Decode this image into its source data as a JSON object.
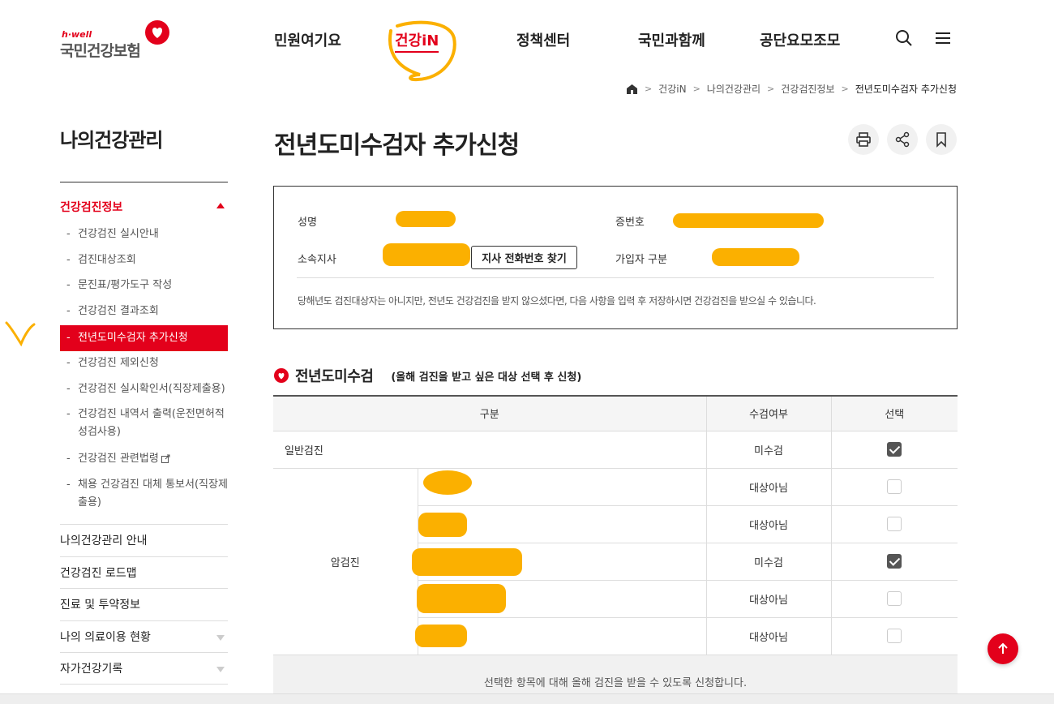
{
  "logo": {
    "small": "h·well",
    "name": "국민건강보험"
  },
  "nav": {
    "items": [
      "민원여기요",
      "건강iN",
      "정책센터",
      "국민과함께",
      "공단요모조모"
    ],
    "active_index": 1
  },
  "icons": {
    "search": "search-icon",
    "menu": "hamburger-menu-icon",
    "home": "home-icon",
    "print": "print-icon",
    "share": "share-icon",
    "bookmark": "bookmark-icon",
    "top": "arrow-up-icon",
    "external": "external-link-icon"
  },
  "breadcrumb": [
    "건강iN",
    "나의건강관리",
    "건강검진정보",
    "전년도미수검자 추가신청"
  ],
  "sidebar": {
    "title": "나의건강관리",
    "group_label": "건강검진정보",
    "sub_items": [
      "건강검진 실시안내",
      "검진대상조회",
      "문진표/평가도구 작성",
      "건강검진 결과조회",
      "전년도미수검자 추가신청",
      "건강검진 제외신청",
      "건강검진 실시확인서(직장제출용)",
      "건강검진 내역서 출력(운전면허적성검사용)",
      "건강검진 관련법령",
      "채용 건강검진 대체 통보서(직장제출용)"
    ],
    "active_sub_index": 4,
    "items": [
      "나의건강관리 안내",
      "건강검진 로드맵",
      "진료 및 투약정보",
      "나의 의료이용 현황",
      "자가건강기록"
    ]
  },
  "page": {
    "title": "전년도미수검자 추가신청"
  },
  "info": {
    "name_label": "성명",
    "cert_label": "증번호",
    "branch_label": "소속지사",
    "find_button": "지사 전화번호 찾기",
    "member_label": "가입자 구분",
    "description": "당해년도 검진대상자는 아니지만, 전년도 건강검진을 받지 않으셨다면, 다음 사항을 입력 후 저장하시면 건강검진을 받으실 수 있습니다."
  },
  "section": {
    "title": "전년도미수검",
    "subtitle": "(올해 검진을 받고 싶은 대상 선택 후 신청)"
  },
  "table": {
    "headers": [
      "구분",
      "수검여부",
      "선택"
    ],
    "general": {
      "label": "일반검진",
      "status": "미수검",
      "checked": true
    },
    "cancer_label": "암검진",
    "cancer_rows": [
      {
        "status": "대상아님",
        "checked": false
      },
      {
        "status": "대상아님",
        "checked": false
      },
      {
        "status": "미수검",
        "checked": true
      },
      {
        "status": "대상아님",
        "checked": false
      },
      {
        "status": "대상아님",
        "checked": false
      }
    ]
  },
  "notice": "선택한 항목에 대해 올해 검진을 받을 수 있도록 신청합니다.",
  "colors": {
    "accent": "#e3001b",
    "redaction": "#fbb000"
  }
}
